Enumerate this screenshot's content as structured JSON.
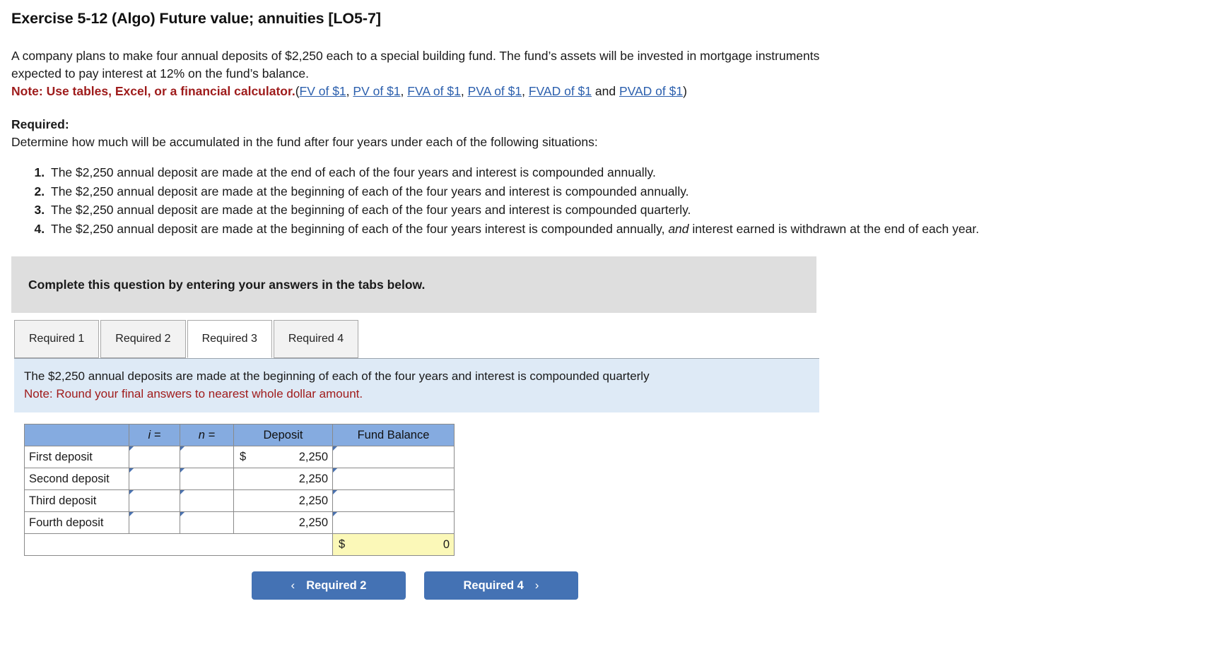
{
  "title": "Exercise 5-12 (Algo) Future value; annuities [LO5-7]",
  "problem": {
    "paragraph": "A company plans to make four annual deposits of $2,250 each to a special building fund. The fund’s assets will be invested in mortgage instruments expected to pay interest at 12% on the fund’s balance.",
    "note_label": "Note: Use tables, Excel, or a financial calculator.",
    "open_paren": "(",
    "close_paren": ")",
    "and_word": " and ",
    "comma": ", ",
    "links": [
      "FV of $1",
      "PV of $1",
      "FVA of $1",
      "PVA of $1",
      "FVAD of $1",
      "PVAD of $1"
    ]
  },
  "required": {
    "heading": "Required:",
    "subheading": "Determine how much will be accumulated in the fund after four years under each of the following situations:",
    "situations": [
      "The $2,250 annual deposit are made at the end of each of the four years and interest is compounded annually.",
      "The $2,250 annual deposit are made at the beginning of each of the four years and interest is compounded annually.",
      "The $2,250 annual deposit are made at the beginning of each of the four years and interest is compounded quarterly.",
      "The $2,250 annual deposit are made at the beginning of each of the four years interest is compounded annually, "
    ],
    "situation4_italic": "and",
    "situation4_tail": " interest earned is withdrawn at the end of each year."
  },
  "instruction_bar": {
    "text": "Complete this question by entering your answers in the tabs below."
  },
  "tabs": [
    {
      "label": "Required 1",
      "active": false
    },
    {
      "label": "Required 2",
      "active": false
    },
    {
      "label": "Required 3",
      "active": true
    },
    {
      "label": "Required 4",
      "active": false
    }
  ],
  "info_panel": {
    "line1": "The $2,250 annual deposits are made at the beginning of each of the four years and interest is compounded quarterly",
    "note": "Note: Round your final answers to nearest whole dollar amount."
  },
  "table": {
    "headers": [
      "",
      "i =",
      "n =",
      "Deposit",
      "Fund Balance"
    ],
    "rows": [
      {
        "label": "First deposit",
        "i": "",
        "n": "",
        "dollar": "$",
        "deposit": "2,250",
        "fund": ""
      },
      {
        "label": "Second deposit",
        "i": "",
        "n": "",
        "dollar": "",
        "deposit": "2,250",
        "fund": ""
      },
      {
        "label": "Third deposit",
        "i": "",
        "n": "",
        "dollar": "",
        "deposit": "2,250",
        "fund": ""
      },
      {
        "label": "Fourth deposit",
        "i": "",
        "n": "",
        "dollar": "",
        "deposit": "2,250",
        "fund": ""
      }
    ],
    "total": {
      "dollar": "$",
      "value": "0"
    }
  },
  "nav": {
    "prev_label": "Required 2",
    "next_label": "Required 4",
    "prev_chevron": "‹",
    "next_chevron": "›"
  },
  "colors": {
    "accent_blue": "#4472b4",
    "header_blue": "#85abe0",
    "panel_blue": "#deeaf6",
    "gray_bar": "#dedede",
    "note_red": "#9e1b1b",
    "link_blue": "#2b5fad",
    "total_yellow": "#fbf8b8"
  }
}
